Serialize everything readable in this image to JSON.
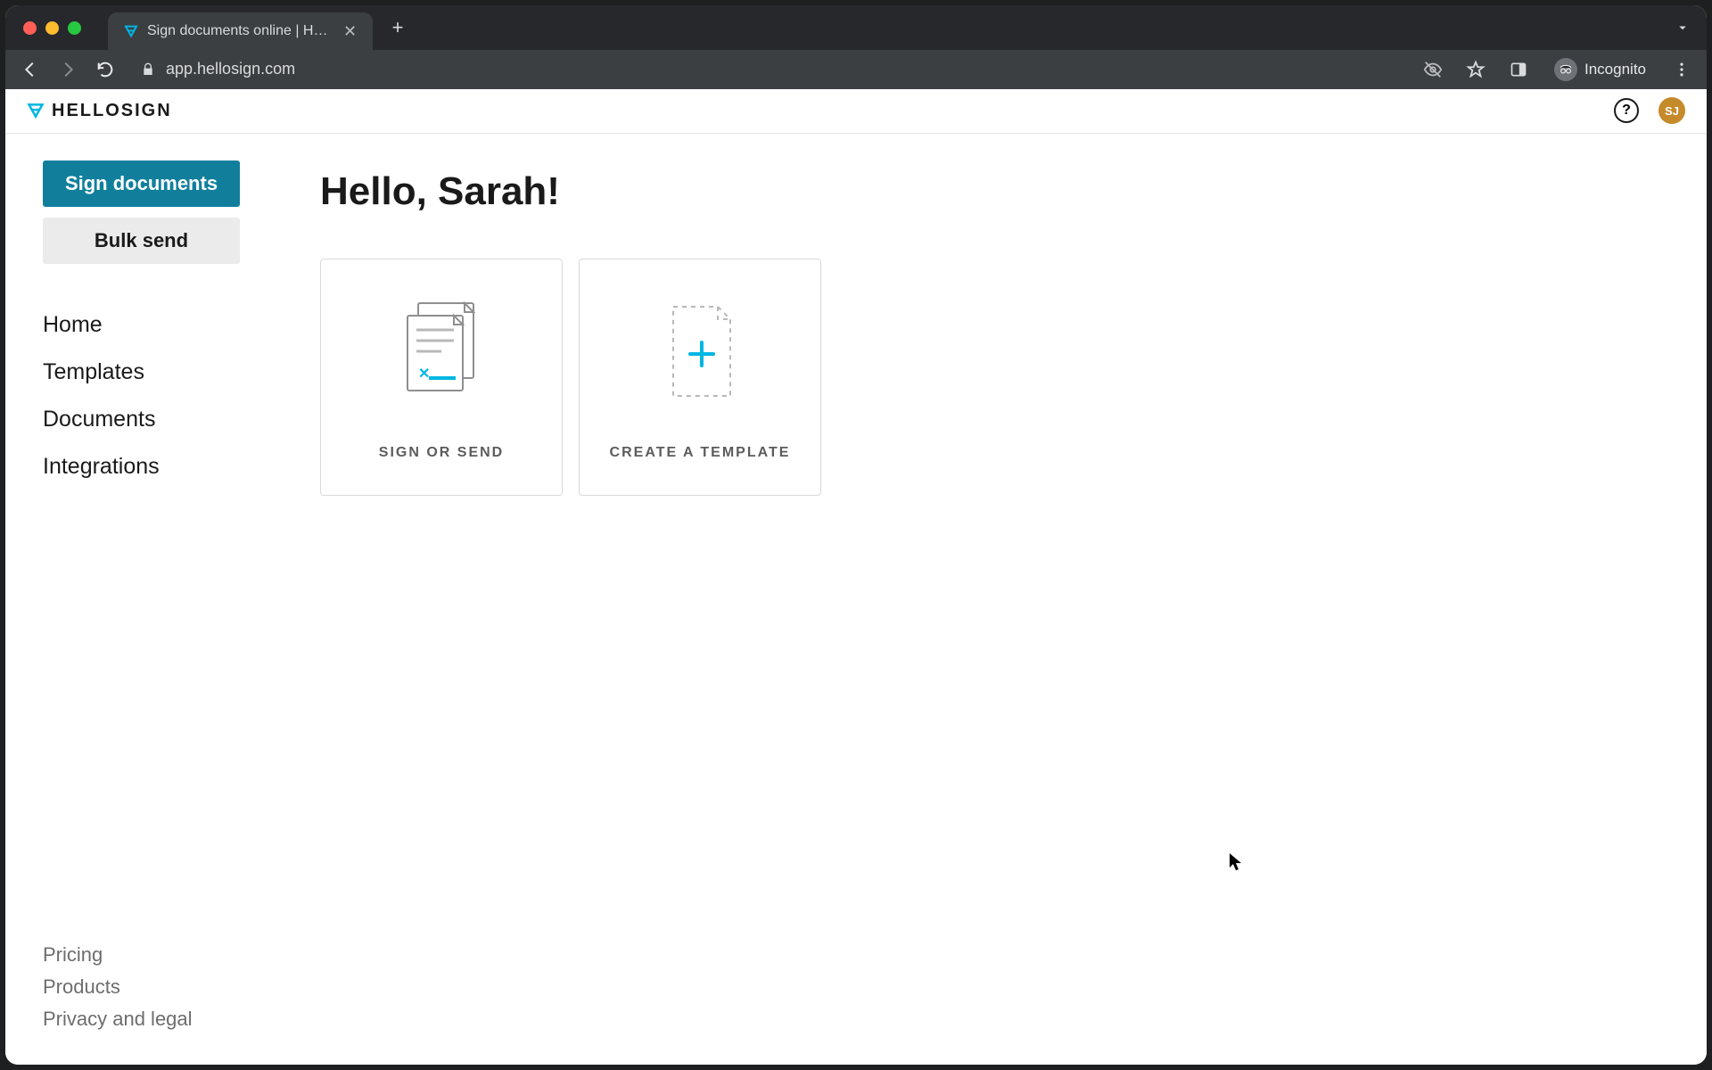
{
  "browser": {
    "tab_title": "Sign documents online | HelloS",
    "url": "app.hellosign.com",
    "incognito_label": "Incognito"
  },
  "header": {
    "logo_text": "HELLOSIGN",
    "user_initials": "SJ"
  },
  "sidebar": {
    "primary_button": "Sign documents",
    "secondary_button": "Bulk send",
    "nav": [
      "Home",
      "Templates",
      "Documents",
      "Integrations"
    ],
    "footer": [
      "Pricing",
      "Products",
      "Privacy and legal"
    ]
  },
  "main": {
    "greeting": "Hello, Sarah!",
    "cards": [
      {
        "label": "SIGN OR SEND"
      },
      {
        "label": "CREATE A TEMPLATE"
      }
    ]
  },
  "colors": {
    "accent": "#00b6e3",
    "primary_button": "#117f9c"
  }
}
